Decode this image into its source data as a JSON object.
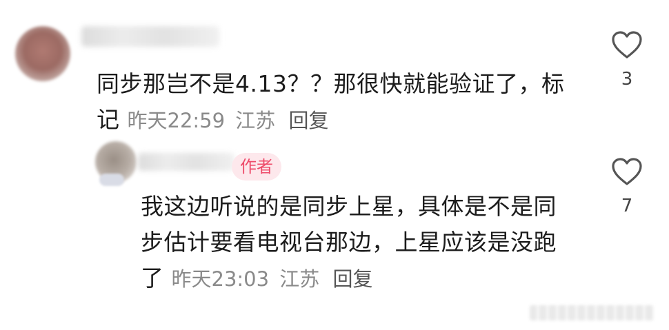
{
  "comments": [
    {
      "text": "同步那岂不是4.13？？那很快就能验证了，标记",
      "time": "昨天22:59",
      "location": "江苏",
      "reply_label": "回复",
      "like_count": "3"
    },
    {
      "badge": "作者",
      "text": "我这边听说的是同步上星，具体是不是同步估计要看电视台那边，上星应该是没跑了",
      "time": "昨天23:03",
      "location": "江苏",
      "reply_label": "回复",
      "like_count": "7"
    }
  ],
  "colors": {
    "badge_text": "#ee4b6a",
    "badge_bg": "#fde8ec",
    "meta_text": "#8a8a8a"
  },
  "icons": {
    "like": "heart-outline-icon"
  }
}
